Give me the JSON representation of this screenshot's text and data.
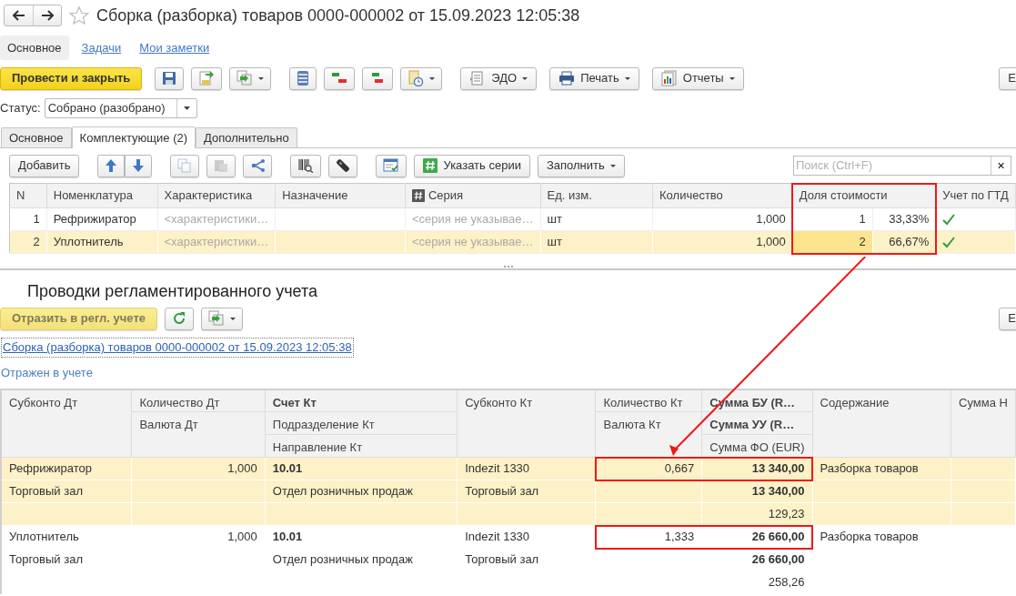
{
  "window": {
    "title": "Сборка (разборка) товаров 0000-000002 от 15.09.2023 12:05:38",
    "favorite": false
  },
  "nav_tabs": [
    {
      "label": "Основное",
      "selected": true
    },
    {
      "label": "Задачи",
      "selected": false
    },
    {
      "label": "Мои заметки",
      "selected": false
    }
  ],
  "toolbar": {
    "groups": [
      {
        "items": [
          {
            "kind": "primary",
            "label": "Провести и закрыть"
          }
        ]
      },
      {
        "items": [
          {
            "kind": "icon",
            "dropdown": false
          },
          {
            "kind": "icon",
            "dropdown": false
          },
          {
            "kind": "icon",
            "dropdown": true
          }
        ]
      },
      {
        "items": [
          {
            "kind": "icon",
            "dropdown": false
          },
          {
            "kind": "icon",
            "dropdown": false
          },
          {
            "kind": "icon",
            "dropdown": false
          },
          {
            "kind": "icon",
            "dropdown": true
          }
        ]
      },
      {
        "items": [
          {
            "kind": "button",
            "label": "ЭДО",
            "dropdown": true
          }
        ]
      },
      {
        "items": [
          {
            "kind": "button",
            "label": "Печать",
            "dropdown": true
          }
        ]
      },
      {
        "items": [
          {
            "kind": "button",
            "label": "Отчеты",
            "dropdown": true
          }
        ]
      }
    ],
    "more": "Е"
  },
  "status": {
    "label": "Статус:",
    "value": "Собрано (разобрано)"
  },
  "form_tabs": [
    {
      "label": "Основное",
      "selected": false
    },
    {
      "label": "Комплектующие (2)",
      "selected": true
    },
    {
      "label": "Дополнительно",
      "selected": false
    }
  ],
  "table_toolbar": {
    "groups": [
      {
        "joined": false,
        "items": [
          {
            "kind": "button",
            "label": "Добавить",
            "dropdown": false
          }
        ]
      },
      {
        "joined": true,
        "items": [
          {
            "kind": "icon",
            "disabled": false
          },
          {
            "kind": "icon",
            "disabled": false
          }
        ]
      },
      {
        "joined": false,
        "items": [
          {
            "kind": "icon",
            "disabled": true
          },
          {
            "kind": "icon",
            "disabled": true
          },
          {
            "kind": "icon",
            "disabled": false
          }
        ]
      },
      {
        "joined": false,
        "items": [
          {
            "kind": "icon",
            "disabled": false
          },
          {
            "kind": "icon",
            "disabled": false
          }
        ]
      },
      {
        "joined": false,
        "items": [
          {
            "kind": "icon",
            "disabled": false
          },
          {
            "kind": "icon_button",
            "label": "Указать серии",
            "dropdown": false
          },
          {
            "kind": "button",
            "label": "Заполнить",
            "dropdown": true
          }
        ]
      }
    ],
    "search": {
      "placeholder": "Поиск (Ctrl+F)",
      "clear": "×"
    }
  },
  "items_table": {
    "columns": [
      {
        "label": "N",
        "kind": "plain",
        "highlighted": false
      },
      {
        "label": "Номенклатура",
        "kind": "plain",
        "highlighted": false
      },
      {
        "label": "Характеристика",
        "kind": "plain",
        "highlighted": false
      },
      {
        "label": "Назначение",
        "kind": "plain",
        "highlighted": false
      },
      {
        "label": "Серия",
        "kind": "series",
        "highlighted": false
      },
      {
        "label": "Ед. изм.",
        "kind": "plain",
        "highlighted": false
      },
      {
        "label": "Количество",
        "kind": "plain",
        "highlighted": false
      },
      {
        "label": "Доля стоимости",
        "kind": "plain",
        "highlighted": true
      },
      {
        "label": "Учет по ГТД",
        "kind": "plain",
        "highlighted": false
      }
    ],
    "rows": [
      {
        "n": "1",
        "name": "Рефрижиратор",
        "characteristic_hint": "<характеристики…",
        "series_hint": "<серия не указывае…",
        "unit": "шт",
        "quantity": "1,000",
        "share": "1",
        "share_percent": "33,33%",
        "gtd": true,
        "selected": false
      },
      {
        "n": "2",
        "name": "Уплотнитель",
        "characteristic_hint": "<характеристики…",
        "series_hint": "<серия не указывае…",
        "unit": "шт",
        "quantity": "1,000",
        "share": "2",
        "share_percent": "66,67%",
        "gtd": true,
        "selected": true
      }
    ]
  },
  "postings": {
    "title": "Проводки регламентированного учета",
    "toolbar": [
      {
        "kind": "primary",
        "label": "Отразить в регл. учете",
        "disabled": true
      },
      {
        "kind": "icon",
        "dropdown": false
      },
      {
        "kind": "icon",
        "dropdown": true
      }
    ],
    "more": "Е",
    "document_link": "Сборка (разборка) товаров 0000-000002 от 15.09.2023 12:05:38",
    "status_link": "Отражен в учете",
    "columns": [
      {
        "kind": "text",
        "highlighted": false,
        "lines": [
          {
            "text": "Субконто Дт",
            "bold": false
          }
        ]
      },
      {
        "kind": "number",
        "highlighted": false,
        "lines": [
          {
            "text": "Количество Дт",
            "bold": false
          },
          {
            "text": "Валюта Дт",
            "bold": false
          }
        ]
      },
      {
        "kind": "text",
        "highlighted": false,
        "lines": [
          {
            "text": "Счет Кт",
            "bold": true
          },
          {
            "text": "Подразделение Кт",
            "bold": false
          },
          {
            "text": "Направление Кт",
            "bold": false
          }
        ]
      },
      {
        "kind": "text",
        "highlighted": false,
        "lines": [
          {
            "text": "Субконто Кт",
            "bold": false
          }
        ]
      },
      {
        "kind": "number",
        "highlighted": true,
        "lines": [
          {
            "text": "Количество Кт",
            "bold": false
          },
          {
            "text": "Валюта Кт",
            "bold": false
          }
        ]
      },
      {
        "kind": "number",
        "highlighted": true,
        "lines": [
          {
            "text": "Сумма БУ (R…",
            "bold": true
          },
          {
            "text": "Сумма УУ (R…",
            "bold": true
          },
          {
            "text": "Сумма ФО (EUR)",
            "bold": false
          }
        ]
      },
      {
        "kind": "text",
        "highlighted": false,
        "lines": [
          {
            "text": "Содержание",
            "bold": false
          }
        ]
      },
      {
        "kind": "text",
        "highlighted": false,
        "lines": [
          {
            "text": "Сумма Н",
            "bold": false
          }
        ]
      }
    ],
    "groups": [
      {
        "selected": true,
        "highlighted": true,
        "cells": [
          [
            "Рефрижиратор",
            "Торговый зал"
          ],
          [
            "1,000"
          ],
          [
            "10.01",
            "Отдел розничных продаж"
          ],
          [
            "Indezit 1330",
            "Торговый зал"
          ],
          [
            "0,667"
          ],
          [
            "13 340,00",
            "13 340,00",
            "129,23"
          ],
          [
            "Разборка товаров"
          ]
        ]
      },
      {
        "selected": false,
        "highlighted": true,
        "cells": [
          [
            "Уплотнитель",
            "Торговый зал"
          ],
          [
            "1,000"
          ],
          [
            "10.01",
            "Отдел розничных продаж"
          ],
          [
            "Indezit 1330",
            "Торговый зал"
          ],
          [
            "1,333"
          ],
          [
            "26 660,00",
            "26 660,00",
            "258,26"
          ],
          [
            "Разборка товаров"
          ]
        ]
      }
    ]
  },
  "annotation_arrow": true
}
